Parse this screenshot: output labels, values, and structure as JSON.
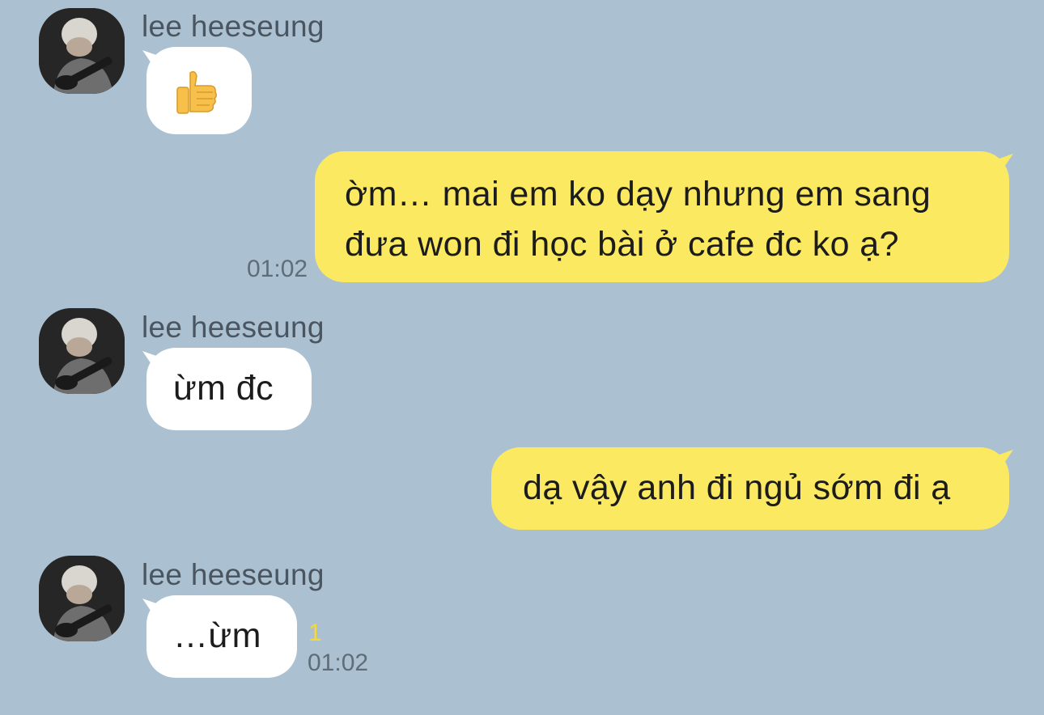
{
  "colors": {
    "background": "#abc1d1",
    "bubble_in": "#ffffff",
    "bubble_out": "#fbe961",
    "unread": "#f5d93a"
  },
  "messages": [
    {
      "sender": "lee heeseung",
      "emoji": "thumbs-up"
    },
    {
      "text_line1": "ờm… mai em ko dạy nhưng em sang",
      "text_line2": "đưa won đi học bài ở cafe đc ko ạ?",
      "time": "01:02"
    },
    {
      "sender": "lee heeseung",
      "text": "ừm đc"
    },
    {
      "text": "dạ vậy anh đi ngủ sớm đi ạ"
    },
    {
      "sender": "lee heeseung",
      "text": "…ừm",
      "unread": "1",
      "time": "01:02"
    }
  ]
}
